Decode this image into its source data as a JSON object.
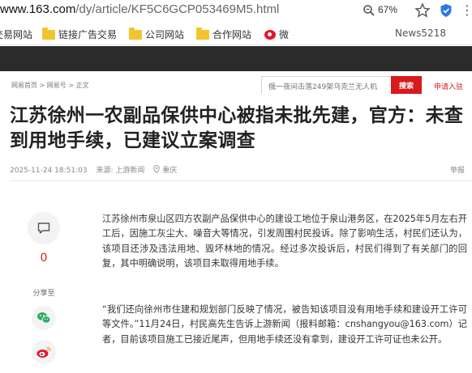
{
  "browser": {
    "url_domain": "www.163.com",
    "url_path": "/dy/article/KF5C6GCP053469M5.html",
    "zoom": "67%"
  },
  "bookmarks": [
    {
      "label": "交易网站",
      "icon": "folder-icon"
    },
    {
      "label": "链接广告交易",
      "icon": "folder-icon"
    },
    {
      "label": "公司网站",
      "icon": "folder-icon"
    },
    {
      "label": "合作网站",
      "icon": "folder-icon"
    },
    {
      "label": "微",
      "icon": "weibo-icon"
    },
    {
      "label": "News5218",
      "icon": ""
    }
  ],
  "nav": {
    "breadcrumb": [
      "网易首页",
      "网易号",
      "正文"
    ],
    "search_placeholder": "俄一夜间击落249架乌克兰无人机",
    "search_button": "搜索",
    "apply": "申请入驻"
  },
  "article": {
    "title": "江苏徐州一农副品保供中心被指未批先建，官方：未查到用地手续，已建议立案调查",
    "date": "2025-11-24 18:51:03",
    "source": "来源: 上游新闻",
    "location": "重庆",
    "report": "举报",
    "paragraphs": [
      "江苏徐州市泉山区四方农副产品保供中心的建设工地位于泉山港务区，在2025年5月左右开工后，因施工灰尘大、噪音大等情况，引发周围村民投诉。除了影响生活，村民们还认为，该项目还涉及违法用地、毁坏林地的情况。经过多次投诉后，村民们得到了有关部门的回复，其中明确说明，该项目未取得用地手续。",
      "“我们还向徐州市住建和规划部门反映了情况，被告知该项目没有用地手续和建设开工许可等文件。”11月24日，村民高先生告诉上游新闻（报料邮箱：cnshangyou@163.com）记者，目前该项目施工已接近尾声，但用地手续还没有拿到，建设开工许可证也未公开。"
    ]
  },
  "sidebar": {
    "comment_count": "0",
    "share_label": "分享至"
  },
  "colors": {
    "accent": "#d71a1b",
    "darkbar": "#2b2b2b"
  }
}
